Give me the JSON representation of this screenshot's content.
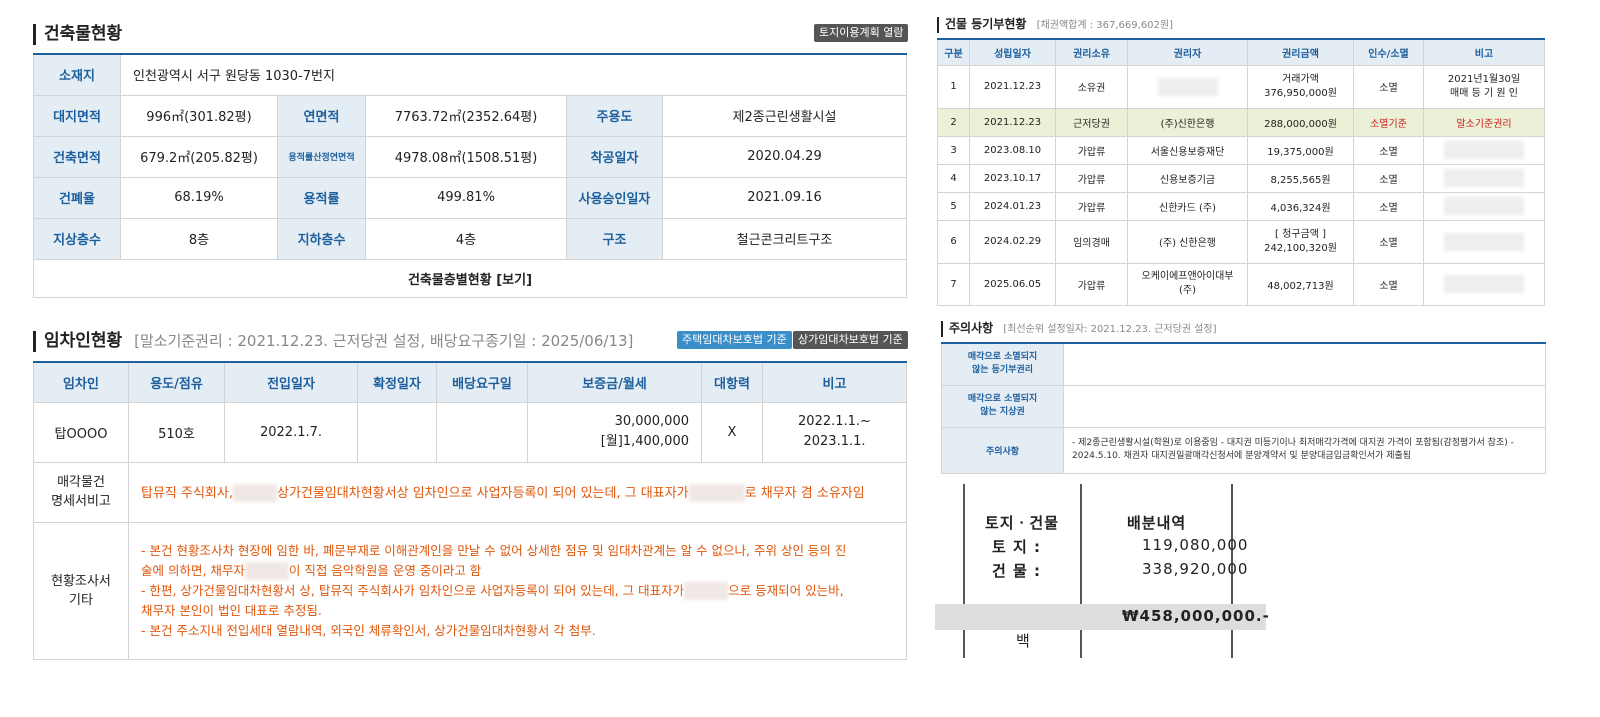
{
  "building": {
    "title": "건축물현황",
    "land_plan_button": "토지이용계획 열람",
    "location_label": "소재지",
    "location_value": "인천광역시 서구 원당동 1030-7번지",
    "rows": [
      [
        "대지면적",
        "996㎡(301.82평)",
        "연면적",
        "7763.72㎡(2352.64평)",
        "주용도",
        "제2종근린생활시설"
      ],
      [
        "건축면적",
        "679.2㎡(205.82평)",
        "용적률산정연면적",
        "4978.08㎡(1508.51평)",
        "착공일자",
        "2020.04.29"
      ],
      [
        "건폐율",
        "68.19%",
        "용적률",
        "499.81%",
        "사용승인일자",
        "2021.09.16"
      ],
      [
        "지상층수",
        "8층",
        "지하층수",
        "4층",
        "구조",
        "철근콘크리트구조"
      ]
    ],
    "floor_link": "건축물층별현황 [보기]"
  },
  "tenant": {
    "title": "임차인현황",
    "subtitle": "[말소기준권리 : 2021.12.23. 근저당권 설정, 배당요구종기일 : 2025/06/13]",
    "btn_housing": "주택임대차보호법 기준",
    "btn_commercial": "상가임대차보호법 기준",
    "headers": [
      "임차인",
      "용도/점유",
      "전입일자",
      "확정일자",
      "배당요구일",
      "보증금/월세",
      "대항력",
      "비고"
    ],
    "row": {
      "name": "탑OOOO",
      "use": "510호",
      "move_in": "2022.1.7.",
      "confirm": "",
      "dividend": "",
      "deposit1": "30,000,000",
      "deposit2": "[월]1,400,000",
      "opposing": "X",
      "note1": "2022.1.1.~",
      "note2": "2023.1.1."
    },
    "spec_label1": "매각물건",
    "spec_label2": "명세서비고",
    "spec_a": "탑뮤직 주식회사,",
    "spec_b": "상가건물임대차현황서상 임차인으로 사업자등록이 되어 있는데, 그 대표자가",
    "spec_c": "로 채무자 겸 소유자임",
    "survey_label1": "현황조사서",
    "survey_label2": "기타",
    "survey_l1": "- 본건 현황조사차 현장에 임한 바, 폐문부재로 이해관계인을 만날 수 없어 상세한 점유 및 임대차관계는 알 수 없으나, 주위 상인 등의 진",
    "survey_l2a": "술에 의하면, 채무자",
    "survey_l2b": "이 직접 음악학원을 운영 중이라고 함",
    "survey_l3a": "- 한편, 상가건물임대차현황서 상, 탑뮤직 주식회사가 임차인으로 사업자등록이 되어 있는데, 그 대표자가",
    "survey_l3b": "으로 등재되어 있는바,",
    "survey_l4": "채무자 본인이 법인 대표로 추정됨.",
    "survey_l5": "- 본건 주소지내 전입세대 열람내역, 외국인 체류확인서, 상가건물임대차현황서 각 첨부."
  },
  "registry": {
    "title": "건물 등기부현황",
    "sum": "[채권액합계 : 367,669,602원]",
    "headers": [
      "구분",
      "성립일자",
      "권리소유",
      "권리자",
      "권리금액",
      "인수/소멸",
      "비고"
    ],
    "rows": [
      {
        "no": "1",
        "date": "2021.12.23",
        "type": "소유권",
        "holder": "",
        "amount": "거래가액",
        "amount2": "376,950,000원",
        "status": "소멸",
        "note": "2021년1월30일",
        "note2": "매매 등 기 원 인"
      },
      {
        "no": "2",
        "date": "2021.12.23",
        "type": "근저당권",
        "holder": "(주)신한은행",
        "amount": "288,000,000원",
        "amount2": "",
        "status": "소멸기준",
        "note": "말소기준권리",
        "note2": ""
      },
      {
        "no": "3",
        "date": "2023.08.10",
        "type": "가압류",
        "holder": "서울신용보증재단",
        "amount": "19,375,000원",
        "amount2": "",
        "status": "소멸",
        "note": "",
        "note2": ""
      },
      {
        "no": "4",
        "date": "2023.10.17",
        "type": "가압류",
        "holder": "신용보증기금",
        "amount": "8,255,565원",
        "amount2": "",
        "status": "소멸",
        "note": "",
        "note2": ""
      },
      {
        "no": "5",
        "date": "2024.01.23",
        "type": "가압류",
        "holder": "신한카드 (주)",
        "amount": "4,036,324원",
        "amount2": "",
        "status": "소멸",
        "note": "",
        "note2": ""
      },
      {
        "no": "6",
        "date": "2024.02.29",
        "type": "임의경매",
        "holder": "(주) 신한은행",
        "amount": "[ 청구금액 ]",
        "amount2": "242,100,320원",
        "status": "소멸",
        "note": "",
        "note2": ""
      },
      {
        "no": "7",
        "date": "2025.06.05",
        "type": "가압류",
        "holder": "오케이에프앤아이대부",
        "holder2": "(주)",
        "amount": "48,002,713원",
        "amount2": "",
        "status": "소멸",
        "note": "",
        "note2": ""
      }
    ]
  },
  "notice": {
    "title": "주의사항",
    "sub": "[최선순위 설정일자: 2021.12.23. 근저당권 설정]",
    "label1a": "매각으로 소멸되지",
    "label1b": "않는 등기부권리",
    "label2a": "매각으로 소멸되지",
    "label2b": "않는 지상권",
    "label3": "주의사항",
    "text1": "- 제2종근린생활시설(학원)로 이용중임 - 대지권 미등기이나 최저매각가격에 대지권 가격이 포함됨(감정평가서 참조) -",
    "text2": "2024.5.10. 채권자 대지권일괄매각신청서에 분양계약서 및 분양대금입금확인서가 제출됨"
  },
  "distribution": {
    "h1": "토지ㆍ건물",
    "h2": "배분내역",
    "land_label": "토 지 :",
    "land_value": "119,080,000",
    "bldg_label": "건 물 :",
    "bldg_value": "338,920,000",
    "total": "₩458,000,000.-",
    "foot": "백"
  }
}
